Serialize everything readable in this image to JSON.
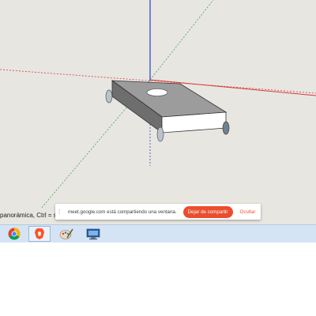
{
  "status_bar": {
    "text": "panorámica, Ctrl = su"
  },
  "share_bar": {
    "message": "meet.google.com está compartiendo una ventana.",
    "stop_label": "Dejar de compartir",
    "hide_label": "Ocultar"
  },
  "taskbar": {
    "items": [
      {
        "icon": "chrome-icon"
      },
      {
        "icon": "brave-icon"
      },
      {
        "icon": "paint-icon"
      },
      {
        "icon": "remote-desktop-icon"
      }
    ]
  },
  "colors": {
    "viewport_bg": "#e8e6e1",
    "axis_red": "#d63a3a",
    "axis_green": "#3aa35a",
    "axis_blue": "#2a3fc9",
    "stop_button": "#ea4e2e",
    "taskbar_bg": "#d5e4f4"
  }
}
